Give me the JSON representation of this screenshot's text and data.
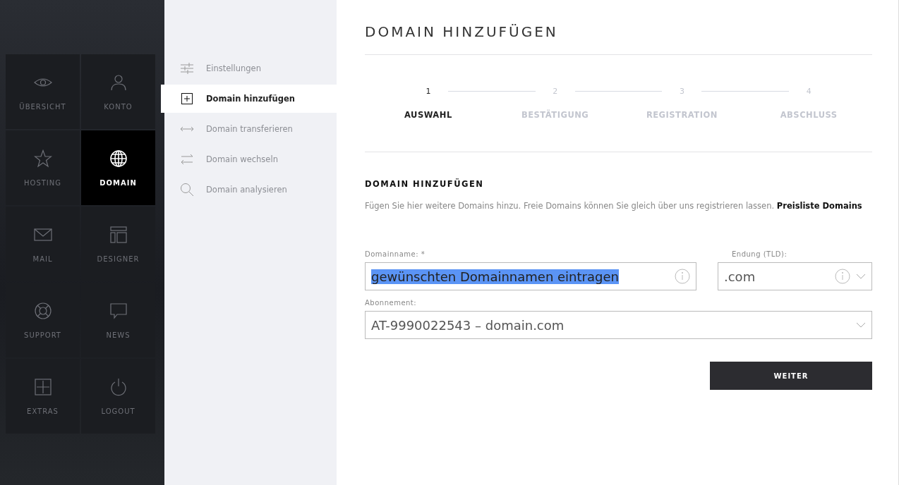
{
  "main_nav": [
    {
      "label": "ÜBERSICHT",
      "selected": false
    },
    {
      "label": "KONTO",
      "selected": false
    },
    {
      "label": "HOSTING",
      "selected": false
    },
    {
      "label": "DOMAIN",
      "selected": true
    },
    {
      "label": "MAIL",
      "selected": false
    },
    {
      "label": "DESIGNER",
      "selected": false
    },
    {
      "label": "SUPPORT",
      "selected": false
    },
    {
      "label": "NEWS",
      "selected": false
    },
    {
      "label": "EXTRAS",
      "selected": false
    },
    {
      "label": "LOGOUT",
      "selected": false
    }
  ],
  "sub_nav": [
    {
      "label": "Einstellungen",
      "selected": false
    },
    {
      "label": "Domain hinzufügen",
      "selected": true
    },
    {
      "label": "Domain transferieren",
      "selected": false
    },
    {
      "label": "Domain wechseln",
      "selected": false
    },
    {
      "label": "Domain analysieren",
      "selected": false
    }
  ],
  "page_title": "DOMAIN HINZUFÜGEN",
  "steps": [
    {
      "number": "1",
      "label": "AUSWAHL",
      "selected": true
    },
    {
      "number": "2",
      "label": "BESTÄTIGUNG",
      "selected": false
    },
    {
      "number": "3",
      "label": "REGISTRATION",
      "selected": false
    },
    {
      "number": "4",
      "label": "ABSCHLUSS",
      "selected": false
    }
  ],
  "section_title": "DOMAIN HINZUFÜGEN",
  "description": "Fügen Sie hier weitere Domains hinzu. Freie Domains können Sie gleich über uns registrieren lassen.",
  "description_link": "Preisliste Domains",
  "domain_field": {
    "label": "Domainname: *",
    "value": "gewünschten Domainnamen eintragen",
    "highlighted": true
  },
  "tld_field": {
    "label": "Endung (TLD):",
    "value": ".com"
  },
  "subscription_field": {
    "label": "Abonnement:",
    "value": "AT-9990022543 – domain.com"
  },
  "submit_button": "WEITER"
}
